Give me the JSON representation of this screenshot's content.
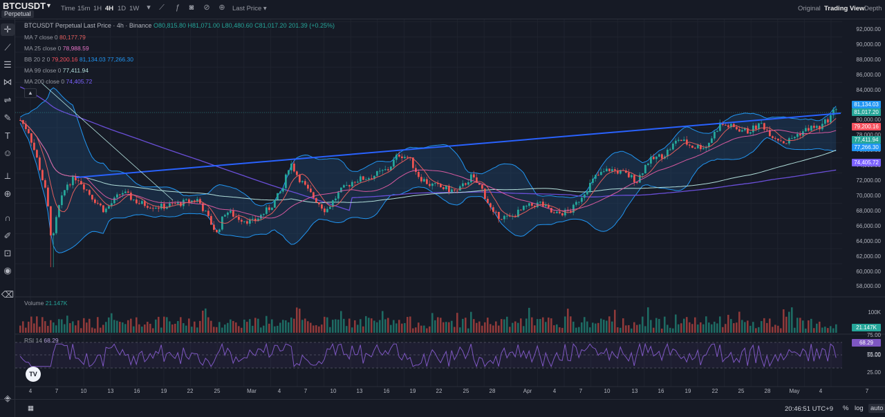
{
  "header": {
    "symbol": "BTCUSDT",
    "market_badge": "Perpetual",
    "timeframes": [
      "Time",
      "15m",
      "1H",
      "4H",
      "1D",
      "1W"
    ],
    "active_timeframe": "4H",
    "price_source": "Last Price",
    "views": [
      "Original",
      "Trading View",
      "Depth"
    ],
    "active_view": "Trading View"
  },
  "chart_header": {
    "title": "BTCUSDT Perpetual Last Price · 4h · Binance",
    "open": "O80,815.80",
    "high": "H81,071.00",
    "low": "L80,480.60",
    "close": "C81,017.20",
    "change": "201.39 (+0.25%)"
  },
  "indicators": [
    {
      "label": "MA 7 close 0",
      "values": [
        "80,177.79"
      ],
      "colors": [
        "#e25d5d"
      ]
    },
    {
      "label": "MA 25 close 0",
      "values": [
        "78,988.59"
      ],
      "colors": [
        "#e573c7"
      ]
    },
    {
      "label": "BB 20 2 0",
      "values": [
        "79,200.16",
        "81,134.03",
        "77,266.30"
      ],
      "colors": [
        "#f7525f",
        "#2196f3",
        "#2196f3"
      ]
    },
    {
      "label": "MA 99 close 0",
      "values": [
        "77,411.94"
      ],
      "colors": [
        "#b2dfdb"
      ]
    },
    {
      "label": "MA 200 close 0",
      "values": [
        "74,405.72"
      ],
      "colors": [
        "#7b61ff"
      ]
    }
  ],
  "price_axis": [
    "92,000.00",
    "90,000.00",
    "88,000.00",
    "86,000.00",
    "84,000.00",
    "82,000.00",
    "80,000.00",
    "78,000.00",
    "76,000.00",
    "74,000.00",
    "72,000.00",
    "70,000.00",
    "68,000.00",
    "66,000.00",
    "64,000.00",
    "62,000.00",
    "60,000.00",
    "58,000.00"
  ],
  "price_tags": [
    {
      "value": "81,134.03",
      "color": "#2196f3"
    },
    {
      "value": "81,017.20",
      "color": "#26a69a"
    },
    {
      "value": "79,200.16",
      "color": "#f7525f"
    },
    {
      "value": "77,411.94",
      "color": "#26a69a"
    },
    {
      "value": "77,266.30",
      "color": "#2196f3"
    },
    {
      "value": "74,405.72",
      "color": "#7b61ff"
    }
  ],
  "volume": {
    "label": "Volume",
    "value": "21.147K",
    "axis_label": "100K",
    "tag": "21.147K"
  },
  "rsi": {
    "label": "RSI 14",
    "value": "68.29",
    "axis": [
      "75.00",
      "50.00",
      "25.00"
    ],
    "tag": "68.29"
  },
  "date_axis": [
    "4",
    "7",
    "10",
    "13",
    "16",
    "19",
    "22",
    "25",
    "Mar",
    "4",
    "7",
    "10",
    "13",
    "16",
    "19",
    "22",
    "25",
    "28",
    "Apr",
    "4",
    "7",
    "10",
    "13",
    "16",
    "19",
    "22",
    "25",
    "28",
    "May",
    "4",
    "7"
  ],
  "footer": {
    "clock": "20:46:51 UTC+9",
    "percent": "%",
    "log": "log",
    "auto": "auto"
  },
  "logo_text": "TV",
  "colors": {
    "up": "#26a69a",
    "down": "#ef5350",
    "trendline": "#2962ff",
    "bb_fill": "#1e3a5f"
  }
}
